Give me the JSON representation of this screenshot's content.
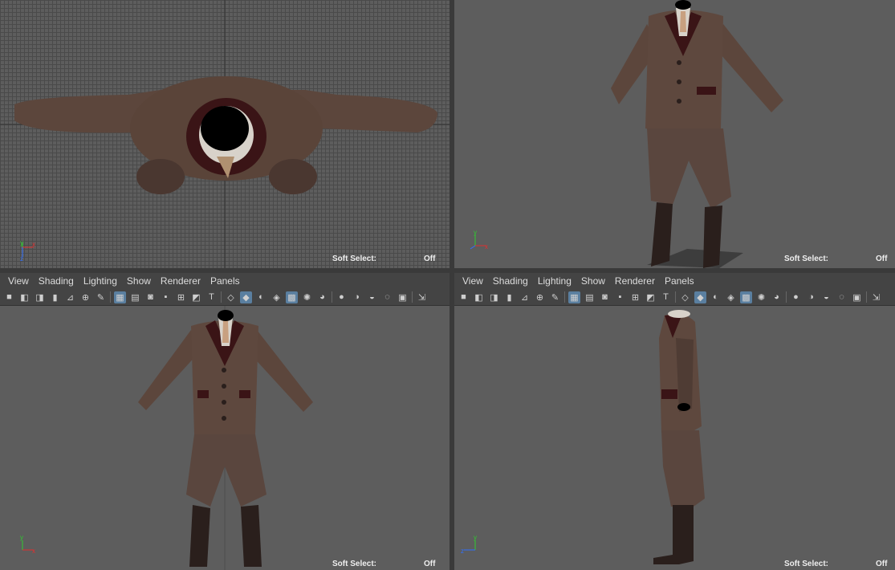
{
  "menu": {
    "items": [
      "View",
      "Shading",
      "Lighting",
      "Show",
      "Renderer",
      "Panels"
    ]
  },
  "hud": {
    "soft_select_label": "Soft Select:",
    "soft_select_value": "Off"
  },
  "axis": {
    "x": "x",
    "y": "y",
    "z": "z"
  },
  "colors": {
    "viewport_bg": "#5d5d5d",
    "grid_line": "#4a4a4a",
    "panel_bg": "#444444",
    "active_tool": "#5a7fa0",
    "jacket": "#5c463c",
    "collar": "#3a1416",
    "boots": "#2a1f1c",
    "shirt": "#d8d2ca"
  },
  "toolbar_icons": [
    "camera-icon",
    "camera-attr-icon",
    "bookmark-icon",
    "image-plane-icon",
    "wireframe-grid-icon",
    "film-gate-icon",
    "resolution-gate-icon",
    "gate-mask-icon",
    "field-chart-icon",
    "safe-action-icon",
    "safe-title-icon",
    "wireframe-icon",
    "smooth-shade-icon",
    "xray-icon",
    "default-material-icon",
    "texture-icon",
    "light-icon",
    "shadow-icon",
    "isolate-icon",
    "xray-joint-icon",
    "ambient-occlusion-icon",
    "motion-blur-icon",
    "multisample-icon",
    "depth-of-field-icon",
    "display-icon"
  ]
}
